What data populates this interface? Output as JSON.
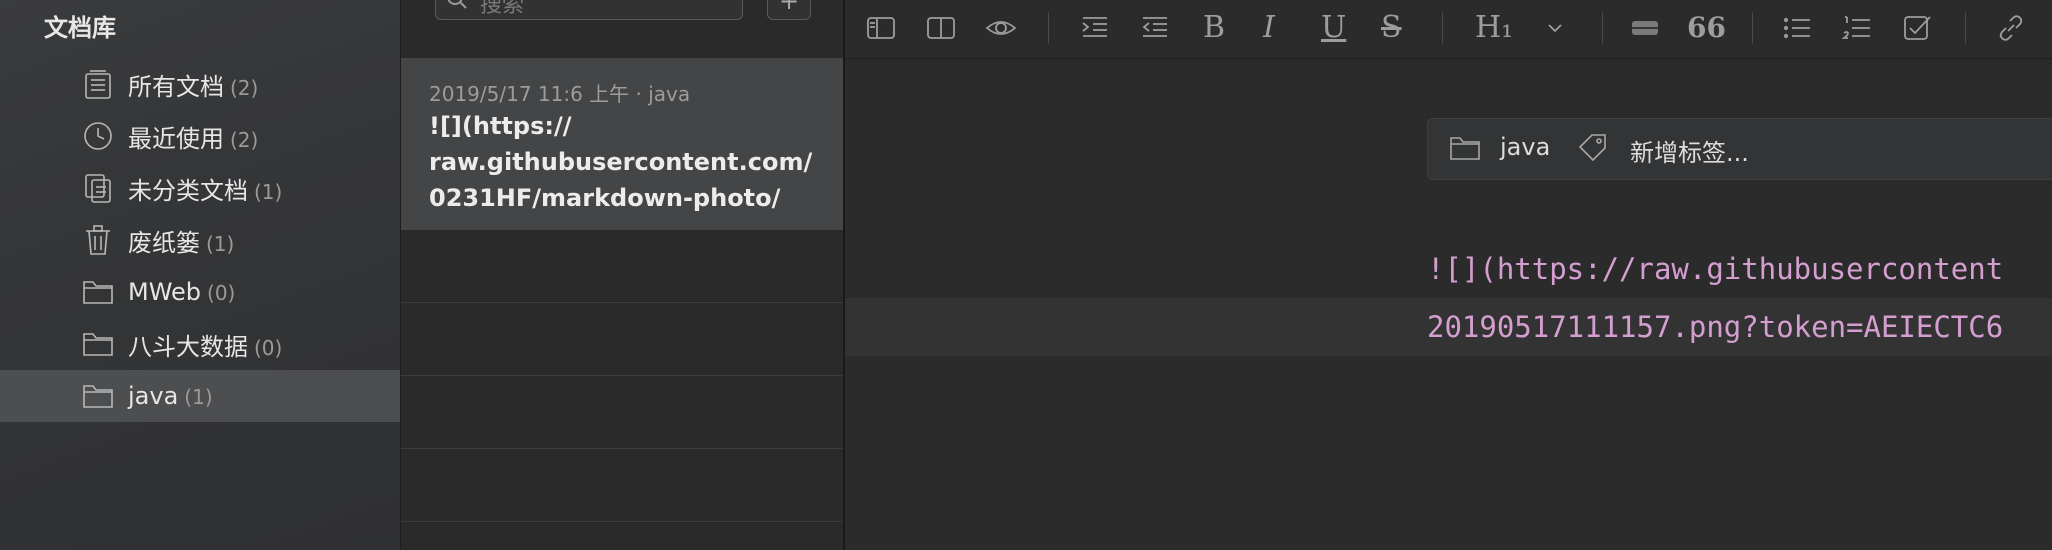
{
  "sidebar": {
    "title": "文档库",
    "items": [
      {
        "label": "所有文档",
        "count": "(2)",
        "icon": "all-docs-icon"
      },
      {
        "label": "最近使用",
        "count": "(2)",
        "icon": "clock-icon"
      },
      {
        "label": "未分类文档",
        "count": "(1)",
        "icon": "uncategorized-doc-icon"
      },
      {
        "label": "废纸篓",
        "count": "(1)",
        "icon": "trash-icon"
      },
      {
        "label": "MWeb",
        "count": "(0)",
        "icon": "folder-icon"
      },
      {
        "label": "八斗大数据",
        "count": "(0)",
        "icon": "folder-icon"
      },
      {
        "label": "java",
        "count": "(1)",
        "icon": "folder-icon"
      }
    ],
    "selected_index": 6
  },
  "notelist": {
    "search_placeholder": "搜索",
    "add_label": "+",
    "selected_note": {
      "meta": "2019/5/17 11:6 上午  · java",
      "title": "![](https://\nraw.githubusercontent.com/\n0231HF/markdown-photo/"
    }
  },
  "editor": {
    "toolbar": {
      "heading_label": "H₁",
      "quote_label": "66",
      "bold_label": "B",
      "italic_label": "I",
      "underline_label": "U",
      "strike_label": "S"
    },
    "tag_bar": {
      "folder": "java",
      "add_tag": "新增标签..."
    },
    "lines": [
      "![](https://raw.githubusercontent",
      "20190517111157.png?token=AEIECTC6"
    ]
  },
  "colors": {
    "accent_code": "#d49fd0",
    "selected_row": "#4d4e50"
  }
}
